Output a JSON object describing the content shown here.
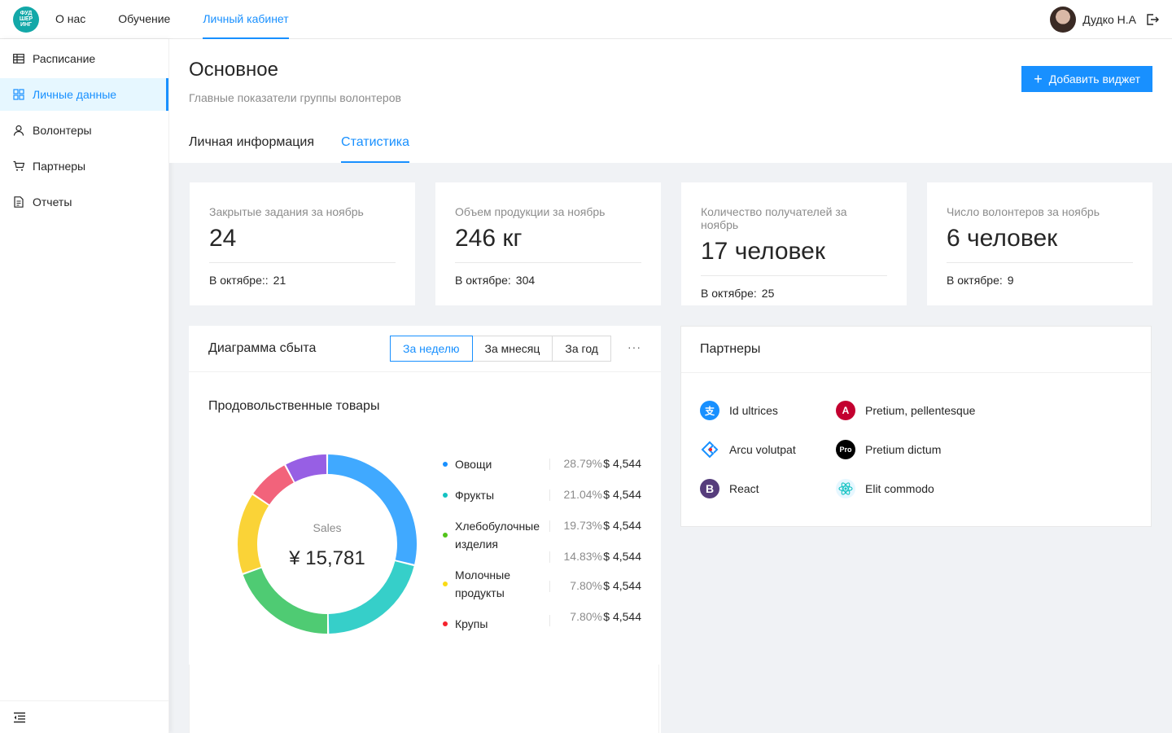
{
  "topbar": {
    "logo_text": "ФУДШЕРИНГ",
    "logo_lines": [
      "ФУД",
      "ШЕР",
      "ИНГ"
    ],
    "nav": [
      {
        "label": "О нас"
      },
      {
        "label": "Обучение"
      },
      {
        "label": "Личный кабинет",
        "active": true
      }
    ],
    "user_name": "Дудко Н.А"
  },
  "sidebar": {
    "items": [
      {
        "label": "Расписание",
        "icon": "table-icon"
      },
      {
        "label": "Личные данные",
        "icon": "dashboard-icon",
        "active": true
      },
      {
        "label": "Волонтеры",
        "icon": "user-icon"
      },
      {
        "label": "Партнеры",
        "icon": "cart-icon"
      },
      {
        "label": "Отчеты",
        "icon": "file-icon"
      }
    ]
  },
  "header": {
    "title": "Основное",
    "subtitle": "Главные показатели группы волонтеров",
    "add_widget_label": "Добавить виджет",
    "tabs": [
      {
        "label": "Личная информация"
      },
      {
        "label": "Статистика",
        "active": true
      }
    ]
  },
  "stats": [
    {
      "label": "Закрытые задания за ноябрь",
      "value": "24",
      "foot_label": "В октябре::",
      "foot_value": "21"
    },
    {
      "label": "Объем продукции за ноябрь",
      "value": "246 кг",
      "foot_label": "В октябре:",
      "foot_value": "304"
    },
    {
      "label": "Количество получателей за ноябрь",
      "value": "17 человек",
      "foot_label": "В октябре:",
      "foot_value": "25"
    },
    {
      "label": "Число волонтеров за ноябрь",
      "value": "6 человек",
      "foot_label": "В октябре:",
      "foot_value": "9"
    }
  ],
  "sales": {
    "title": "Диаграмма сбыта",
    "periods": [
      {
        "label": "За неделю",
        "active": true
      },
      {
        "label": "За мнесяц"
      },
      {
        "label": "За год"
      }
    ],
    "more": "···",
    "subtitle": "Продовольственные товары",
    "center_label": "Sales",
    "center_value": "¥ 15,781",
    "legend": [
      {
        "name": "Овощи",
        "pct": "28.79%",
        "value": "$ 4,544",
        "color": "#1890ff"
      },
      {
        "name": "Фрукты",
        "pct": "21.04%",
        "value": "$ 4,544",
        "color": "#13c2c2"
      },
      {
        "name": "Хлебобулочные изделия",
        "pct": "19.73%",
        "value": "$ 4,544",
        "color": "#52c41a"
      },
      {
        "name": "",
        "pct": "14.83%",
        "value": "$ 4,544",
        "color": ""
      },
      {
        "name": "Молочные продукты",
        "pct": "7.80%",
        "value": "$ 4,544",
        "color": "#fadb14"
      },
      {
        "name": "Крупы",
        "pct": "7.80%",
        "value": "$ 4,544",
        "color": "#f5222d"
      }
    ]
  },
  "chart_data": {
    "type": "pie",
    "title": "Продовольственные товары",
    "series": [
      {
        "values": [
          28.79,
          21.04,
          19.73,
          14.83,
          7.8,
          7.8
        ]
      }
    ],
    "colors": [
      "#40a9ff",
      "#36cfc9",
      "#4fcb73",
      "#fad337",
      "#f2637b",
      "#975fe4"
    ]
  },
  "partners": {
    "title": "Партнеры",
    "items": [
      {
        "name": "Id ultrices",
        "icon": "alipay-icon",
        "color": "#1890ff"
      },
      {
        "name": "Pretium, pellentesque",
        "icon": "angular-icon",
        "color": "#c3002f"
      },
      {
        "name": "Arcu volutpat",
        "icon": "antdesign-icon",
        "color": "#1890ff"
      },
      {
        "name": "Pretium dictum",
        "icon": "pro-icon",
        "color": "#000000"
      },
      {
        "name": "React",
        "icon": "bootstrap-icon",
        "color": "#563d7c"
      },
      {
        "name": "Elit commodo",
        "icon": "react-icon",
        "color": "#61dafb"
      }
    ]
  }
}
